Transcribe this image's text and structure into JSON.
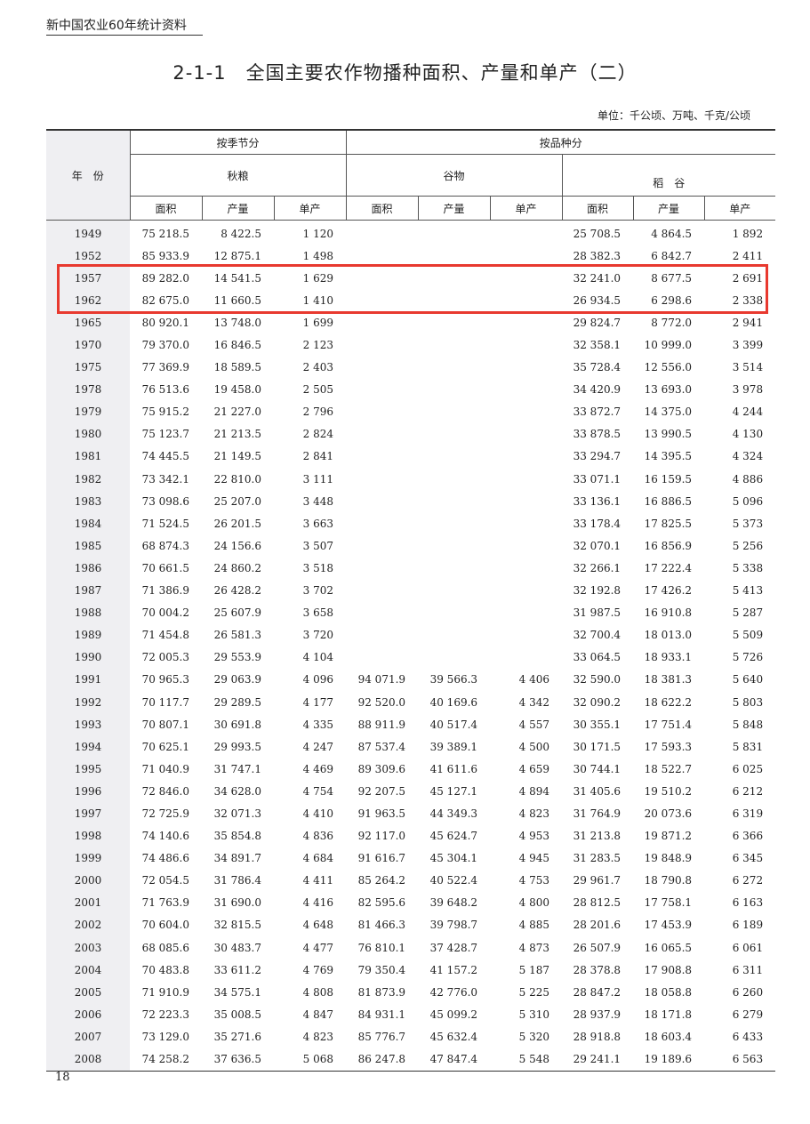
{
  "header": {
    "book_title": "新中国农业60年统计资料"
  },
  "title": "2-1-1　全国主要农作物播种面积、产量和单产（二）",
  "unit": "单位：千公顷、万吨、千克/公顷",
  "columns": {
    "year": "年　份",
    "by_season": "按季节分",
    "by_variety": "按品种分",
    "autumn_grain": "秋粮",
    "cereals": "谷物",
    "rice": "稻　谷",
    "area": "面积",
    "output": "产量",
    "yield": "单产"
  },
  "rows": [
    [
      "1949",
      "75 218.5",
      "8 422.5",
      "1 120",
      "",
      "",
      "",
      "25 708.5",
      "4 864.5",
      "1 892"
    ],
    [
      "1952",
      "85 933.9",
      "12 875.1",
      "1 498",
      "",
      "",
      "",
      "28 382.3",
      "6 842.7",
      "2 411"
    ],
    [
      "1957",
      "89 282.0",
      "14 541.5",
      "1 629",
      "",
      "",
      "",
      "32 241.0",
      "8 677.5",
      "2 691"
    ],
    [
      "1962",
      "82 675.0",
      "11 660.5",
      "1 410",
      "",
      "",
      "",
      "26 934.5",
      "6 298.6",
      "2 338"
    ],
    [
      "1965",
      "80 920.1",
      "13 748.0",
      "1 699",
      "",
      "",
      "",
      "29 824.7",
      "8 772.0",
      "2 941"
    ],
    [
      "1970",
      "79 370.0",
      "16 846.5",
      "2 123",
      "",
      "",
      "",
      "32 358.1",
      "10 999.0",
      "3 399"
    ],
    [
      "1975",
      "77 369.9",
      "18 589.5",
      "2 403",
      "",
      "",
      "",
      "35 728.4",
      "12 556.0",
      "3 514"
    ],
    [
      "1978",
      "76 513.6",
      "19 458.0",
      "2 505",
      "",
      "",
      "",
      "34 420.9",
      "13 693.0",
      "3 978"
    ],
    [
      "1979",
      "75 915.2",
      "21 227.0",
      "2 796",
      "",
      "",
      "",
      "33 872.7",
      "14 375.0",
      "4 244"
    ],
    [
      "1980",
      "75 123.7",
      "21 213.5",
      "2 824",
      "",
      "",
      "",
      "33 878.5",
      "13 990.5",
      "4 130"
    ],
    [
      "1981",
      "74 445.5",
      "21 149.5",
      "2 841",
      "",
      "",
      "",
      "33 294.7",
      "14 395.5",
      "4 324"
    ],
    [
      "1982",
      "73 342.1",
      "22 810.0",
      "3 111",
      "",
      "",
      "",
      "33 071.1",
      "16 159.5",
      "4 886"
    ],
    [
      "1983",
      "73 098.6",
      "25 207.0",
      "3 448",
      "",
      "",
      "",
      "33 136.1",
      "16 886.5",
      "5 096"
    ],
    [
      "1984",
      "71 524.5",
      "26 201.5",
      "3 663",
      "",
      "",
      "",
      "33 178.4",
      "17 825.5",
      "5 373"
    ],
    [
      "1985",
      "68 874.3",
      "24 156.6",
      "3 507",
      "",
      "",
      "",
      "32 070.1",
      "16 856.9",
      "5 256"
    ],
    [
      "1986",
      "70 661.5",
      "24 860.2",
      "3 518",
      "",
      "",
      "",
      "32 266.1",
      "17 222.4",
      "5 338"
    ],
    [
      "1987",
      "71 386.9",
      "26 428.2",
      "3 702",
      "",
      "",
      "",
      "32 192.8",
      "17 426.2",
      "5 413"
    ],
    [
      "1988",
      "70 004.2",
      "25 607.9",
      "3 658",
      "",
      "",
      "",
      "31 987.5",
      "16 910.8",
      "5 287"
    ],
    [
      "1989",
      "71 454.8",
      "26 581.3",
      "3 720",
      "",
      "",
      "",
      "32 700.4",
      "18 013.0",
      "5 509"
    ],
    [
      "1990",
      "72 005.3",
      "29 553.9",
      "4 104",
      "",
      "",
      "",
      "33 064.5",
      "18 933.1",
      "5 726"
    ],
    [
      "1991",
      "70 965.3",
      "29 063.9",
      "4 096",
      "94 071.9",
      "39 566.3",
      "4 406",
      "32 590.0",
      "18 381.3",
      "5 640"
    ],
    [
      "1992",
      "70 117.7",
      "29 289.5",
      "4 177",
      "92 520.0",
      "40 169.6",
      "4 342",
      "32 090.2",
      "18 622.2",
      "5 803"
    ],
    [
      "1993",
      "70 807.1",
      "30 691.8",
      "4 335",
      "88 911.9",
      "40 517.4",
      "4 557",
      "30 355.1",
      "17 751.4",
      "5 848"
    ],
    [
      "1994",
      "70 625.1",
      "29 993.5",
      "4 247",
      "87 537.4",
      "39 389.1",
      "4 500",
      "30 171.5",
      "17 593.3",
      "5 831"
    ],
    [
      "1995",
      "71 040.9",
      "31 747.1",
      "4 469",
      "89 309.6",
      "41 611.6",
      "4 659",
      "30 744.1",
      "18 522.7",
      "6 025"
    ],
    [
      "1996",
      "72 846.0",
      "34 628.0",
      "4 754",
      "92 207.5",
      "45 127.1",
      "4 894",
      "31 405.6",
      "19 510.2",
      "6 212"
    ],
    [
      "1997",
      "72 725.9",
      "32 071.3",
      "4 410",
      "91 963.5",
      "44 349.3",
      "4 823",
      "31 764.9",
      "20 073.6",
      "6 319"
    ],
    [
      "1998",
      "74 140.6",
      "35 854.8",
      "4 836",
      "92 117.0",
      "45 624.7",
      "4 953",
      "31 213.8",
      "19 871.2",
      "6 366"
    ],
    [
      "1999",
      "74 486.6",
      "34 891.7",
      "4 684",
      "91 616.7",
      "45 304.1",
      "4 945",
      "31 283.5",
      "19 848.9",
      "6 345"
    ],
    [
      "2000",
      "72 054.5",
      "31 786.4",
      "4 411",
      "85 264.2",
      "40 522.4",
      "4 753",
      "29 961.7",
      "18 790.8",
      "6 272"
    ],
    [
      "2001",
      "71 763.9",
      "31 690.0",
      "4 416",
      "82 595.6",
      "39 648.2",
      "4 800",
      "28 812.5",
      "17 758.1",
      "6 163"
    ],
    [
      "2002",
      "70 604.0",
      "32 815.5",
      "4 648",
      "81 466.3",
      "39 798.7",
      "4 885",
      "28 201.6",
      "17 453.9",
      "6 189"
    ],
    [
      "2003",
      "68 085.6",
      "30 483.7",
      "4 477",
      "76 810.1",
      "37 428.7",
      "4 873",
      "26 507.9",
      "16 065.5",
      "6 061"
    ],
    [
      "2004",
      "70 483.8",
      "33 611.2",
      "4 769",
      "79 350.4",
      "41 157.2",
      "5 187",
      "28 378.8",
      "17 908.8",
      "6 311"
    ],
    [
      "2005",
      "71 910.9",
      "34 575.1",
      "4 808",
      "81 873.9",
      "42 776.0",
      "5 225",
      "28 847.2",
      "18 058.8",
      "6 260"
    ],
    [
      "2006",
      "72 223.3",
      "35 008.5",
      "4 847",
      "84 931.1",
      "45 099.2",
      "5 310",
      "28 937.9",
      "18 171.8",
      "6 279"
    ],
    [
      "2007",
      "73 129.0",
      "35 271.6",
      "4 823",
      "85 776.7",
      "45 632.4",
      "5 320",
      "28 918.8",
      "18 603.4",
      "6 433"
    ],
    [
      "2008",
      "74 258.2",
      "37 636.5",
      "5 068",
      "86 247.8",
      "47 847.4",
      "5 548",
      "29 241.1",
      "19 189.6",
      "6 563"
    ]
  ],
  "highlight": {
    "color": "#e8392f",
    "rows": [
      "1957",
      "1962"
    ]
  },
  "page_number": "18"
}
